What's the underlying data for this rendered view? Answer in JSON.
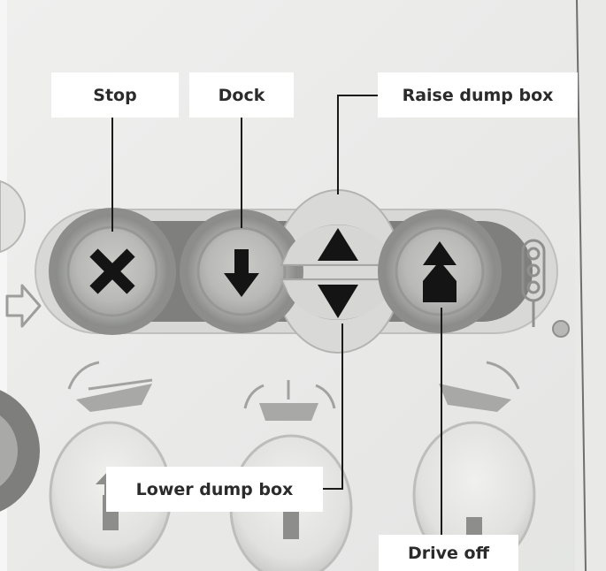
{
  "callouts": {
    "stop": "Stop",
    "dock": "Dock",
    "raise": "Raise dump box",
    "lower": "Lower dump box",
    "drive_off": "Drive off"
  },
  "icons": {
    "stop": "x-icon",
    "dock": "arrow-down-icon",
    "raise": "triangle-up-icon",
    "lower": "triangle-down-icon",
    "drive_off": "double-arrow-up-icon",
    "traffic_light": "traffic-light-icon",
    "side_arrow": "arrow-right-icon"
  },
  "colors": {
    "panel": "#ecedec",
    "button_ring": "#9a9b98",
    "button_face": "#bdbebb",
    "symbol": "#141414",
    "label_bg": "#ffffff",
    "label_text": "#2b2b2b",
    "leader": "#1a1a1a"
  }
}
